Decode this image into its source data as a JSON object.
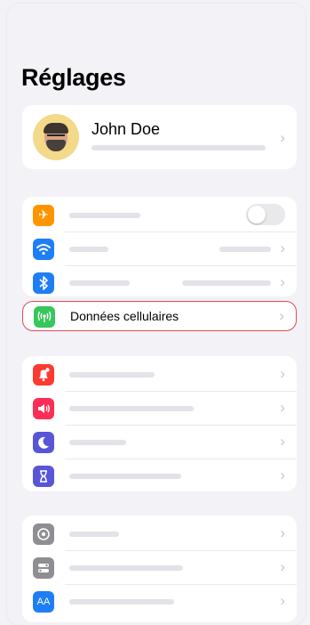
{
  "page_title": "Réglages",
  "profile": {
    "name": "John Doe"
  },
  "highlighted_item": {
    "label": "Données cellulaires",
    "icon": "cellular-antenna-icon",
    "color": "#35c759"
  },
  "groups": [
    {
      "items": [
        {
          "icon": "airplane-icon",
          "color": "#fe9500",
          "control": "toggle-off"
        },
        {
          "icon": "wifi-icon",
          "color": "#1e7ef5",
          "control": "chevron"
        },
        {
          "icon": "bluetooth-icon",
          "color": "#1e7ef5",
          "control": "chevron"
        }
      ]
    },
    {
      "items": [
        {
          "icon": "notifications-bell-icon",
          "color": "#fd3a30",
          "control": "chevron"
        },
        {
          "icon": "sounds-speaker-icon",
          "color": "#fd2d55",
          "control": "chevron"
        },
        {
          "icon": "focus-moon-icon",
          "color": "#5856d6",
          "control": "chevron"
        },
        {
          "icon": "screen-time-hourglass-icon",
          "color": "#5856d6",
          "control": "chevron"
        }
      ]
    },
    {
      "items": [
        {
          "icon": "general-gear-icon",
          "color": "#8e8e93",
          "control": "chevron"
        },
        {
          "icon": "control-center-toggles-icon",
          "color": "#8e8e93",
          "control": "chevron"
        },
        {
          "icon": "display-text-size-icon",
          "color": "#1e7ef5",
          "control": "chevron",
          "glyph": "AA"
        }
      ]
    }
  ],
  "chevron_glyph": "›"
}
